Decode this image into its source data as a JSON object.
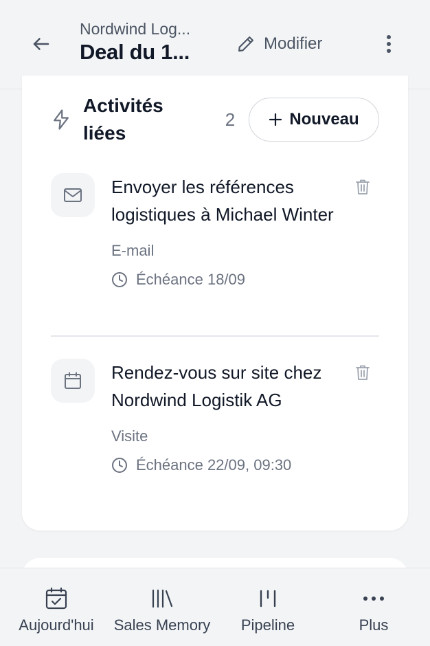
{
  "header": {
    "subtitle": "Nordwind Log...",
    "title": "Deal du 1...",
    "edit_label": "Modifier"
  },
  "activities_card": {
    "title": "Activités liées",
    "count": "2",
    "new_label": "Nouveau",
    "items": [
      {
        "icon": "mail-icon",
        "title": "Envoyer les références logistiques à Michael Winter",
        "type": "E-mail",
        "due": "Échéance 18/09"
      },
      {
        "icon": "calendar-icon",
        "title": "Rendez-vous sur site chez Nordwind Logistik AG",
        "type": "Visite",
        "due": "Échéance 22/09, 09:30"
      }
    ]
  },
  "bottom_nav": {
    "items": [
      {
        "label": "Aujourd'hui",
        "icon": "calendar-check-icon"
      },
      {
        "label": "Sales Memory",
        "icon": "library-icon"
      },
      {
        "label": "Pipeline",
        "icon": "pipeline-icon"
      },
      {
        "label": "Plus",
        "icon": "more-horizontal-icon"
      }
    ]
  },
  "colors": {
    "background": "#f3f4f6",
    "card": "#ffffff",
    "text_primary": "#111827",
    "text_secondary": "#6b7280"
  }
}
